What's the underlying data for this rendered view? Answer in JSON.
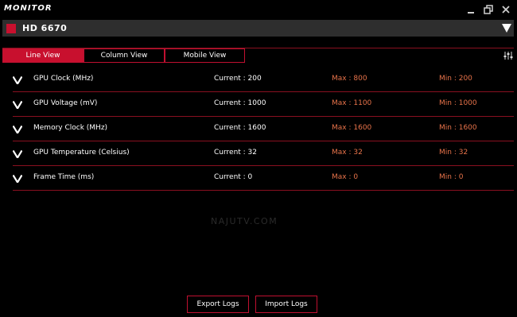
{
  "app": {
    "title": "MONITOR"
  },
  "window_controls": [
    {
      "name": "minimize-icon"
    },
    {
      "name": "restore-icon"
    },
    {
      "name": "close-icon"
    }
  ],
  "device": {
    "name": "HD 6670",
    "accent": "#c8102e"
  },
  "tabs": [
    {
      "label": "Line View",
      "active": true
    },
    {
      "label": "Column View",
      "active": false
    },
    {
      "label": "Mobile View",
      "active": false
    }
  ],
  "metrics": [
    {
      "label": "GPU Clock (MHz)",
      "current": "Current : 200",
      "max": "Max : 800",
      "min": "Min : 200"
    },
    {
      "label": "GPU Voltage (mV)",
      "current": "Current : 1000",
      "max": "Max : 1100",
      "min": "Min : 1000"
    },
    {
      "label": "Memory Clock (MHz)",
      "current": "Current : 1600",
      "max": "Max : 1600",
      "min": "Min : 1600"
    },
    {
      "label": "GPU Temperature (Celsius)",
      "current": "Current : 32",
      "max": "Max : 32",
      "min": "Min : 32"
    },
    {
      "label": "Frame Time (ms)",
      "current": "Current : 0",
      "max": "Max : 0",
      "min": "Min : 0"
    }
  ],
  "watermark": "NAJUTV.COM",
  "footer": {
    "export_label": "Export Logs",
    "import_label": "Import Logs"
  },
  "colors": {
    "accent": "#c8102e",
    "stat": "#e8734a",
    "divider": "#8a1020"
  }
}
